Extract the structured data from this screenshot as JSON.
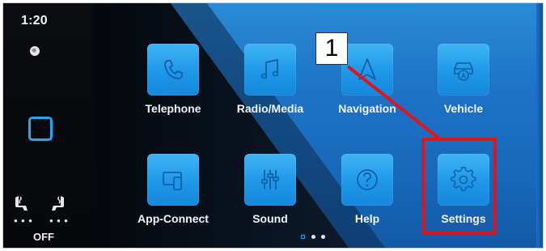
{
  "status": {
    "time": "1:20",
    "seat_off_label": "OFF"
  },
  "apps": [
    {
      "label": "Telephone",
      "icon": "phone-icon"
    },
    {
      "label": "Radio/Media",
      "icon": "music-note-icon"
    },
    {
      "label": "Navigation",
      "icon": "navigation-arrow-icon"
    },
    {
      "label": "Vehicle",
      "icon": "car-icon"
    },
    {
      "label": "App-Connect",
      "icon": "app-connect-icon"
    },
    {
      "label": "Sound",
      "icon": "equalizer-icon"
    },
    {
      "label": "Help",
      "icon": "help-icon"
    },
    {
      "label": "Settings",
      "icon": "gear-icon"
    }
  ],
  "pagination": {
    "pages": 3,
    "current": 1
  },
  "annotation": {
    "callout_number": "1",
    "highlight_target": "Settings",
    "color": "#e0141c"
  },
  "colors": {
    "tile": "#1e97e8",
    "background": "#1e73c7",
    "accent": "#22a7f0"
  }
}
